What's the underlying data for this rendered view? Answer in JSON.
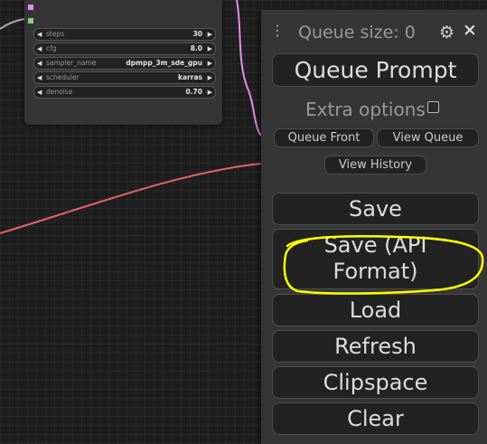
{
  "node": {
    "widgets": [
      {
        "name": "steps",
        "value": "30"
      },
      {
        "name": "cfg",
        "value": "8.0"
      },
      {
        "name": "sampler_name",
        "value": "dpmpp_3m_sde_gpu"
      },
      {
        "name": "scheduler",
        "value": "karras"
      },
      {
        "name": "denoise",
        "value": "0.70"
      }
    ]
  },
  "menu": {
    "drag_icon": "⋮",
    "queue_size": "Queue size: 0",
    "settings_icon": "gear-icon",
    "close_icon": "×",
    "queue_prompt": "Queue Prompt",
    "extra_options": "Extra options",
    "queue_front": "Queue Front",
    "view_queue": "View Queue",
    "view_history": "View History",
    "save": "Save",
    "save_api_line1": "Save (API",
    "save_api_line2": "Format)",
    "load": "Load",
    "refresh": "Refresh",
    "clipspace": "Clipspace",
    "clear": "Clear"
  },
  "colors": {
    "background": "#1e1e1e",
    "panel": "#353535",
    "button": "#222222",
    "wire_pink": "#e58ce8",
    "wire_red": "#e56464",
    "annotation": "#ffff00"
  }
}
